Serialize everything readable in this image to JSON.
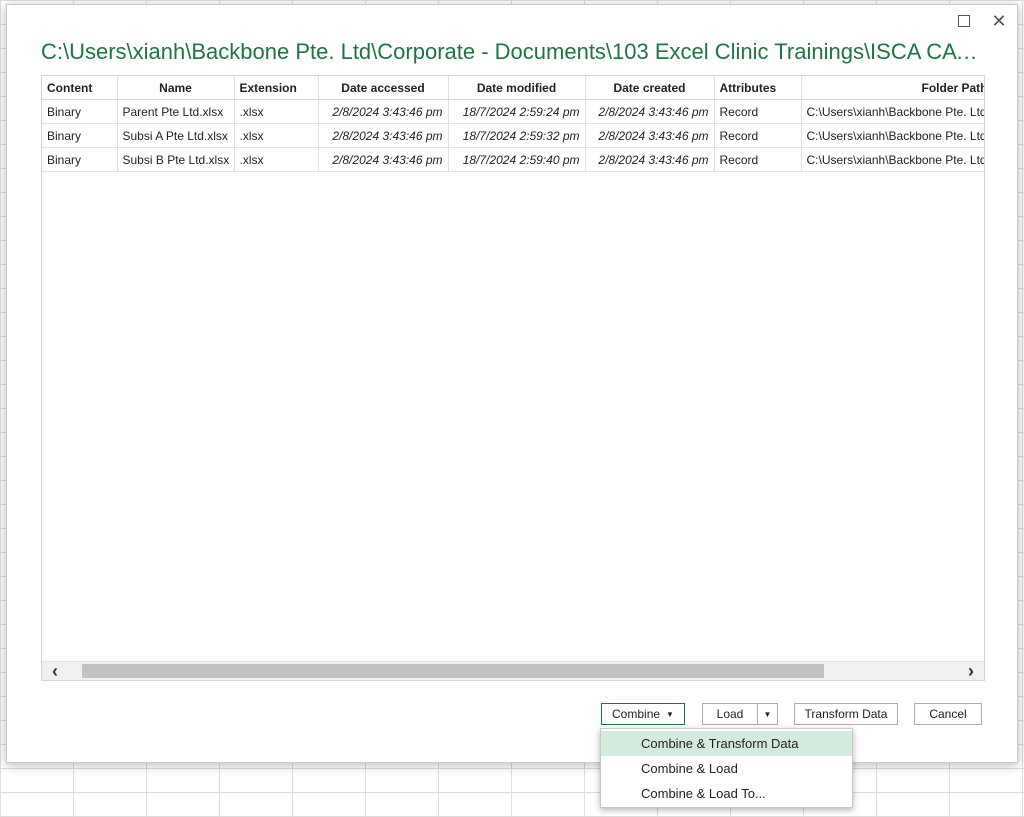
{
  "window": {
    "title": "C:\\Users\\xianh\\Backbone Pte. Ltd\\Corporate - Documents\\103 Excel Clinic Trainings\\ISCA CA La...",
    "maximize_glyph": "",
    "close_glyph": "✕"
  },
  "table": {
    "headers": [
      "Content",
      "Name",
      "Extension",
      "Date accessed",
      "Date modified",
      "Date created",
      "Attributes",
      "Folder Path"
    ],
    "rows": [
      {
        "content": "Binary",
        "name": "Parent Pte Ltd.xlsx",
        "extension": ".xlsx",
        "date_accessed": "2/8/2024 3:43:46 pm",
        "date_modified": "18/7/2024 2:59:24 pm",
        "date_created": "2/8/2024 3:43:46 pm",
        "attributes": "Record",
        "folder_path": "C:\\Users\\xianh\\Backbone Pte. Ltd"
      },
      {
        "content": "Binary",
        "name": "Subsi A Pte Ltd.xlsx",
        "extension": ".xlsx",
        "date_accessed": "2/8/2024 3:43:46 pm",
        "date_modified": "18/7/2024 2:59:32 pm",
        "date_created": "2/8/2024 3:43:46 pm",
        "attributes": "Record",
        "folder_path": "C:\\Users\\xianh\\Backbone Pte. Ltd"
      },
      {
        "content": "Binary",
        "name": "Subsi B Pte Ltd.xlsx",
        "extension": ".xlsx",
        "date_accessed": "2/8/2024 3:43:46 pm",
        "date_modified": "18/7/2024 2:59:40 pm",
        "date_created": "2/8/2024 3:43:46 pm",
        "attributes": "Record",
        "folder_path": "C:\\Users\\xianh\\Backbone Pte. Ltd"
      }
    ]
  },
  "scrollbar": {
    "left_arrow": "‹",
    "right_arrow": "›"
  },
  "buttons": {
    "combine": "Combine",
    "caret": "▼",
    "load": "Load",
    "transform": "Transform Data",
    "cancel": "Cancel"
  },
  "combine_menu": {
    "items": [
      "Combine & Transform Data",
      "Combine & Load",
      "Combine & Load To..."
    ]
  },
  "colors": {
    "title": "#217346",
    "highlight": "#d3ebdc"
  }
}
